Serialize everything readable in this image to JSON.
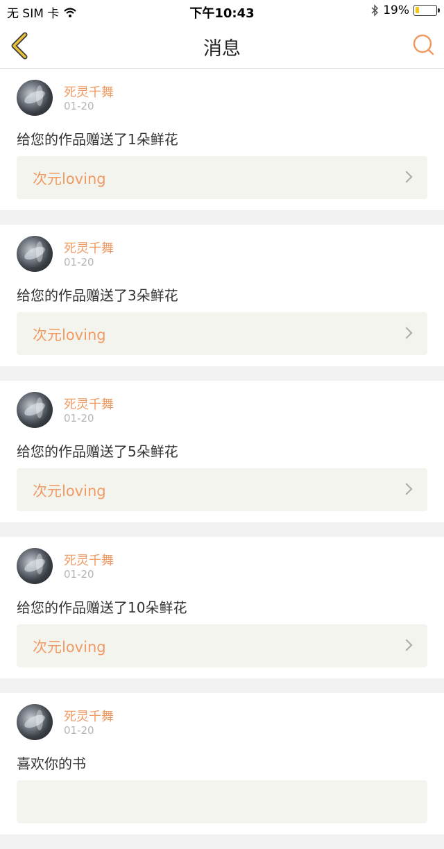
{
  "status_bar": {
    "carrier": "无 SIM 卡",
    "time": "下午10:43",
    "battery": "19%",
    "battery_level": 0.19
  },
  "header": {
    "title": "消息",
    "back_icon": "chevron-left-icon",
    "search_icon": "search-icon"
  },
  "colors": {
    "accent": "#ef9a63",
    "back": "#e8c33a"
  },
  "messages": [
    {
      "user": "死灵千舞",
      "date": "01-20",
      "text": "给您的作品赠送了1朵鲜花",
      "work": "次元loving"
    },
    {
      "user": "死灵千舞",
      "date": "01-20",
      "text": "给您的作品赠送了3朵鲜花",
      "work": "次元loving"
    },
    {
      "user": "死灵千舞",
      "date": "01-20",
      "text": "给您的作品赠送了5朵鲜花",
      "work": "次元loving"
    },
    {
      "user": "死灵千舞",
      "date": "01-20",
      "text": "给您的作品赠送了10朵鲜花",
      "work": "次元loving"
    },
    {
      "user": "死灵千舞",
      "date": "01-20",
      "text": "喜欢你的书",
      "work": ""
    }
  ]
}
